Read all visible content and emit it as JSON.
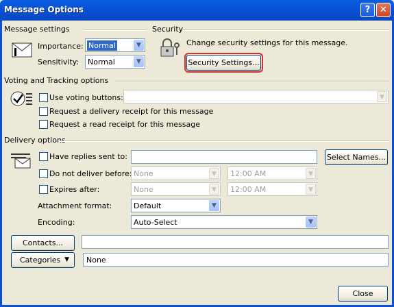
{
  "window": {
    "title": "Message Options",
    "help_button": "?",
    "close_button": "✕"
  },
  "message_settings": {
    "heading": "Message settings",
    "importance_label": "Importance:",
    "importance_value": "Normal",
    "sensitivity_label": "Sensitivity:",
    "sensitivity_value": "Normal"
  },
  "security": {
    "heading": "Security",
    "description": "Change security settings for this message.",
    "settings_button": "Security Settings..."
  },
  "voting": {
    "heading": "Voting and Tracking options",
    "use_voting_label": "Use voting buttons:",
    "voting_value": "",
    "delivery_receipt_label": "Request a delivery receipt for this message",
    "read_receipt_label": "Request a read receipt for this message"
  },
  "delivery": {
    "heading": "Delivery options",
    "replies_label": "Have replies sent to:",
    "replies_value": "",
    "select_names_button": "Select Names...",
    "do_not_deliver_label": "Do not deliver before:",
    "do_not_deliver_date": "None",
    "do_not_deliver_time": "12:00 AM",
    "expires_label": "Expires after:",
    "expires_date": "None",
    "expires_time": "12:00 AM",
    "attachment_label": "Attachment format:",
    "attachment_value": "Default",
    "encoding_label": "Encoding:",
    "encoding_value": "Auto-Select"
  },
  "contacts": {
    "button": "Contacts...",
    "value": ""
  },
  "categories": {
    "button": "Categories",
    "value": "None"
  },
  "footer": {
    "close_button": "Close"
  }
}
